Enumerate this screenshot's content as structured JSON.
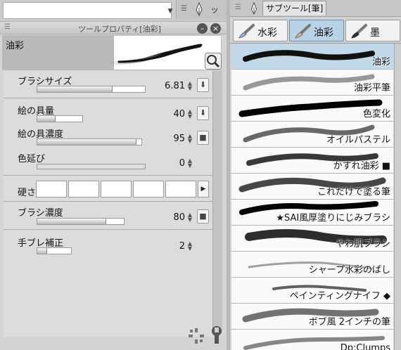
{
  "colors": {
    "selected_row": "#c2d9ea",
    "selected_group": "#b9d3e6",
    "panel_bg": "#d4d4d4"
  },
  "top_tabs": {
    "mini_tab_glyph": "ッ"
  },
  "tool_property": {
    "title": "ツールプロパティ[油彩]",
    "preview_name": "油彩",
    "params": [
      {
        "label": "ブラシサイズ",
        "value": "6.81",
        "fill": 0.7,
        "button": "brush-size-dynamics"
      },
      {
        "label": "絵の具量",
        "value": "40",
        "fill": 0.4,
        "button": "paint-amount-dynamics"
      },
      {
        "label": "絵の具濃度",
        "value": "95",
        "fill": 0.95,
        "button": "paint-density-toggle"
      },
      {
        "label": "色延び",
        "value": "0",
        "fill": 0.0,
        "button": null
      },
      {
        "label": "ブラシ濃度",
        "value": "80",
        "fill": 0.8,
        "button": "brush-density-toggle"
      },
      {
        "label": "手ブレ補正",
        "value": "2",
        "fill": 0.3,
        "button": null
      }
    ],
    "hardness_label": "硬さ"
  },
  "sub_tool": {
    "tab_label": "サブツール[筆]",
    "groups": [
      {
        "label": "水彩",
        "selected": false
      },
      {
        "label": "油彩",
        "selected": true
      },
      {
        "label": "墨",
        "selected": false
      }
    ],
    "brushes": [
      {
        "name": "油彩",
        "selected": true
      },
      {
        "name": "油彩平筆",
        "selected": false
      },
      {
        "name": "色変化",
        "selected": false
      },
      {
        "name": "オイルパステル",
        "selected": false
      },
      {
        "name": "かすれ油彩 ■",
        "selected": false
      },
      {
        "name": "これだけで塗る筆",
        "selected": false
      },
      {
        "name": "★SAI風厚塗りにじみブラシ",
        "selected": false
      },
      {
        "name": "やわ肌ブラシ",
        "selected": false
      },
      {
        "name": "シャープ水彩のばし",
        "selected": false
      },
      {
        "name": "ペインティングナイフ ◆",
        "selected": false
      },
      {
        "name": "ボブ風 2インチの筆",
        "selected": false
      },
      {
        "name": "Dp:Clumps",
        "selected": false
      }
    ]
  }
}
